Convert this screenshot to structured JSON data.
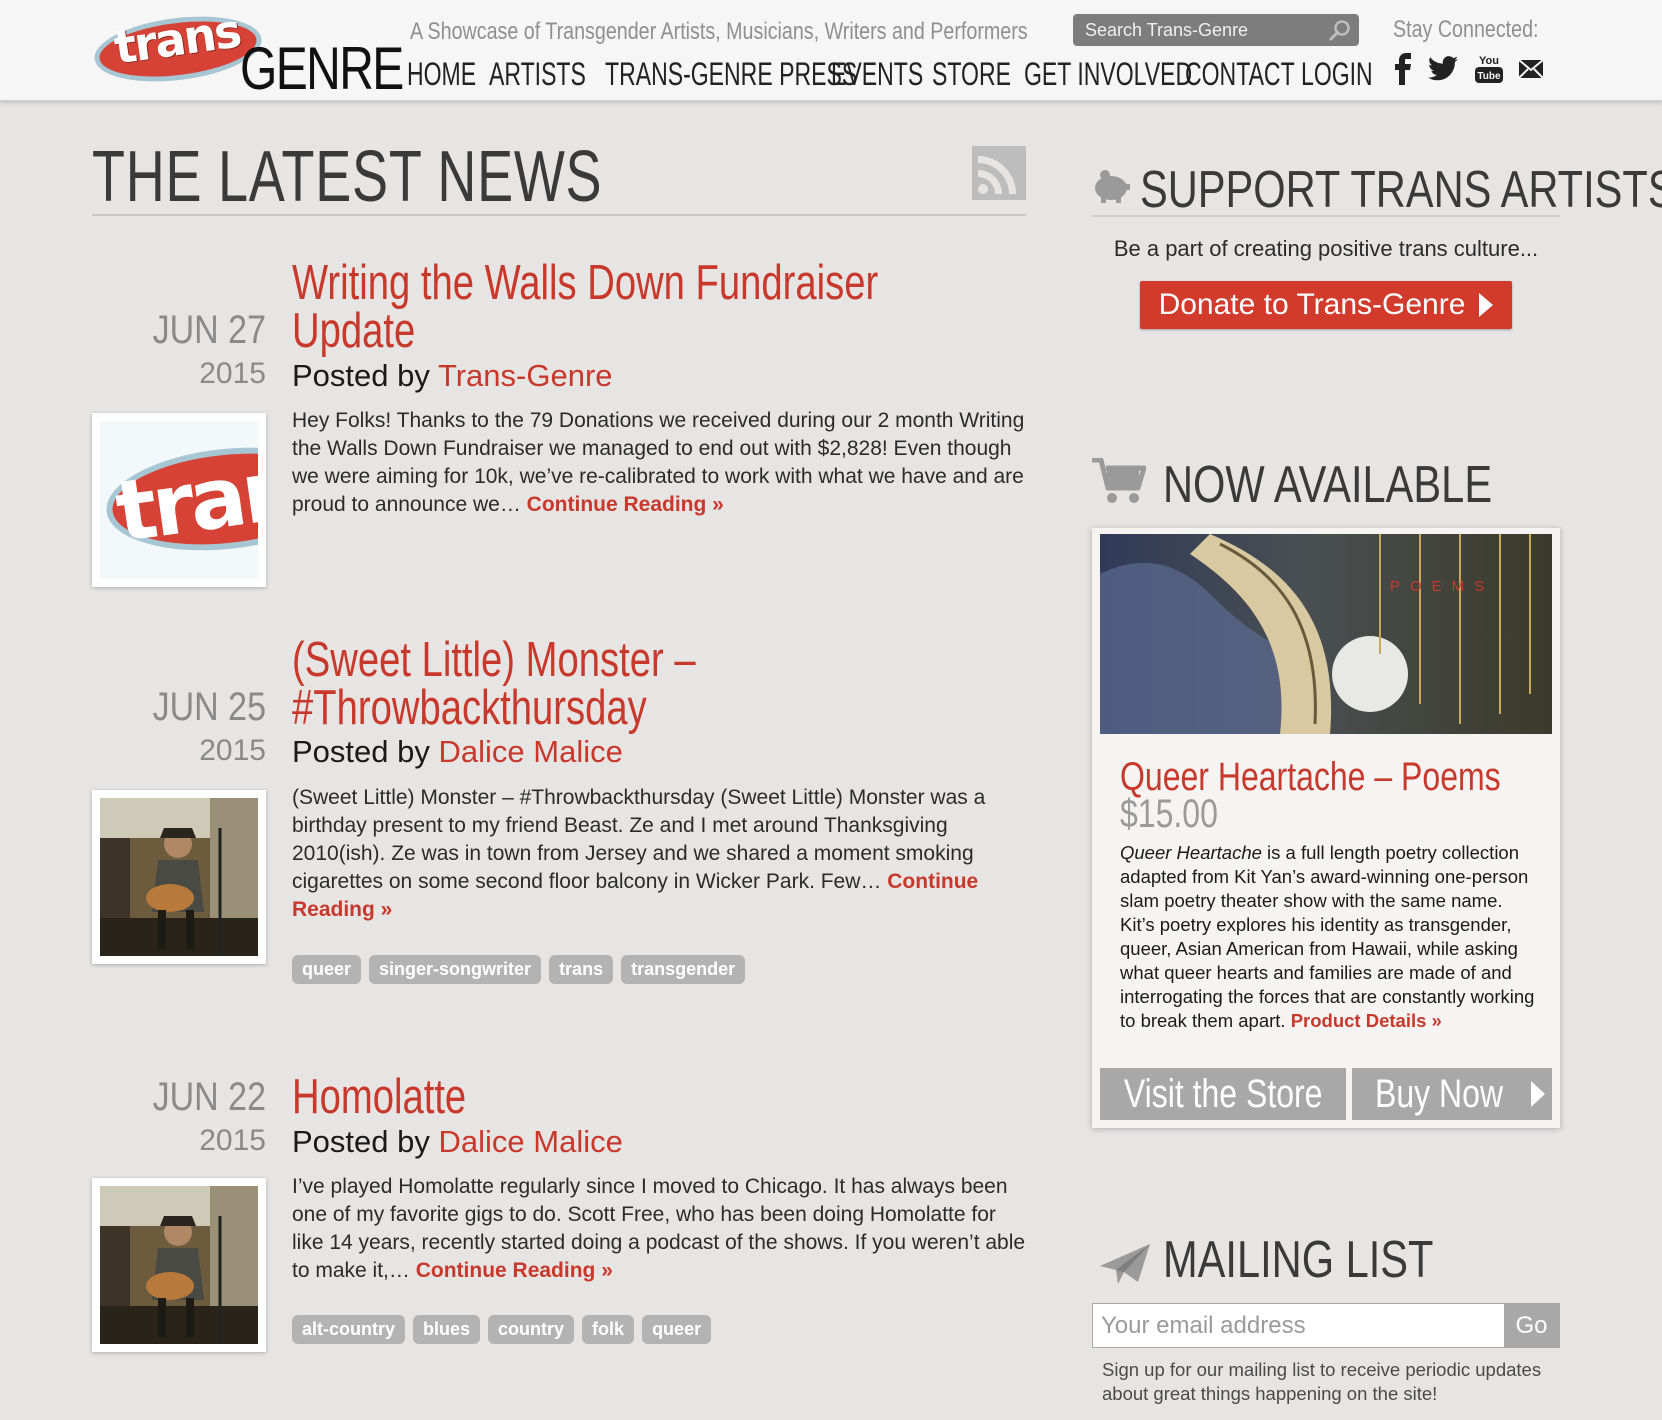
{
  "header": {
    "logo_trans": "trans",
    "logo_genre": "GENRE",
    "tagline": "A Showcase of Transgender Artists, Musicians, Writers and Performers",
    "search_placeholder": "Search Trans-Genre",
    "stay_connected": "Stay Connected:",
    "nav": [
      "HOME",
      "ARTISTS",
      "TRANS-GENRE PRESS",
      "EVENTS",
      "STORE",
      "GET INVOLVED",
      "CONTACT",
      "LOGIN"
    ],
    "social_icons": [
      "facebook-icon",
      "twitter-icon",
      "youtube-icon",
      "mail-icon"
    ],
    "youtube_text": "You Tube"
  },
  "news": {
    "title": "THE LATEST NEWS",
    "posts": [
      {
        "month_day": "JUN 27",
        "year": "2015",
        "title_lines": [
          "Writing the Walls Down Fundraiser",
          "Update"
        ],
        "posted_by": "Posted by",
        "author": "Trans-Genre",
        "excerpt": "Hey Folks! Thanks to the 79 Donations we received during our 2 month Writing the Walls Down Fundraiser we managed to end out with $2,828! Even though we were aiming for 10k, we’ve re-calibrated to work with what we have and are proud to announce we…",
        "continue": "Continue Reading »",
        "tags": []
      },
      {
        "month_day": "JUN 25",
        "year": "2015",
        "title_lines": [
          "(Sweet Little) Monster –",
          "#Throwbackthursday"
        ],
        "posted_by": "Posted by",
        "author": "Dalice Malice",
        "excerpt": "(Sweet Little) Monster – #Throwbackthursday (Sweet Little) Monster was a birthday present to my friend Beast. Ze and I met around Thanksgiving 2010(ish). Ze was in town from Jersey and we shared a moment smoking cigarettes on some second floor balcony in Wicker Park. Few…",
        "continue": "Continue Reading »",
        "tags": [
          "queer",
          "singer-songwriter",
          "trans",
          "transgender"
        ]
      },
      {
        "month_day": "JUN 22",
        "year": "2015",
        "title_lines": [
          "Homolatte"
        ],
        "posted_by": "Posted by",
        "author": "Dalice Malice",
        "excerpt": "I’ve played Homolatte regularly since I moved to Chicago. It has always been one of my favorite gigs to do. Scott Free, who has been doing Homolatte for like 14 years, recently started doing a podcast of the shows. If you weren’t able to make it,…",
        "continue": "Continue Reading »",
        "tags": [
          "alt-country",
          "blues",
          "country",
          "folk",
          "queer"
        ]
      }
    ]
  },
  "sidebar": {
    "support_title": "SUPPORT TRANS ARTISTS",
    "support_sub": "Be a part of creating positive trans culture...",
    "donate_label": "Donate to Trans-Genre",
    "now_title": "NOW AVAILABLE",
    "product": {
      "image_text": "POEMS",
      "name": "Queer Heartache – Poems",
      "price": "$15.00",
      "desc_italic": "Queer Heartache",
      "desc": " is a full length poetry collection adapted from Kit Yan’s award-winning one-person slam poetry theater show with the same name. Kit’s poetry explores his identity as transgender, queer, Asian American from Hawaii, while asking what queer hearts and families are made of and interrogating the forces that are constantly working to break them apart. ",
      "details": "Product Details »",
      "store_label": "Visit the Store",
      "buy_label": "Buy Now"
    },
    "mail_title": "MAILING LIST",
    "email_placeholder": "Your email address",
    "go_label": "Go",
    "mail_sub": "Sign up for our mailing list to receive periodic updates about great things happening on the site!"
  },
  "colors": {
    "accent_red": "#c8382b",
    "background": "#e6e5e4",
    "tag_grey": "#b3b3b3"
  }
}
